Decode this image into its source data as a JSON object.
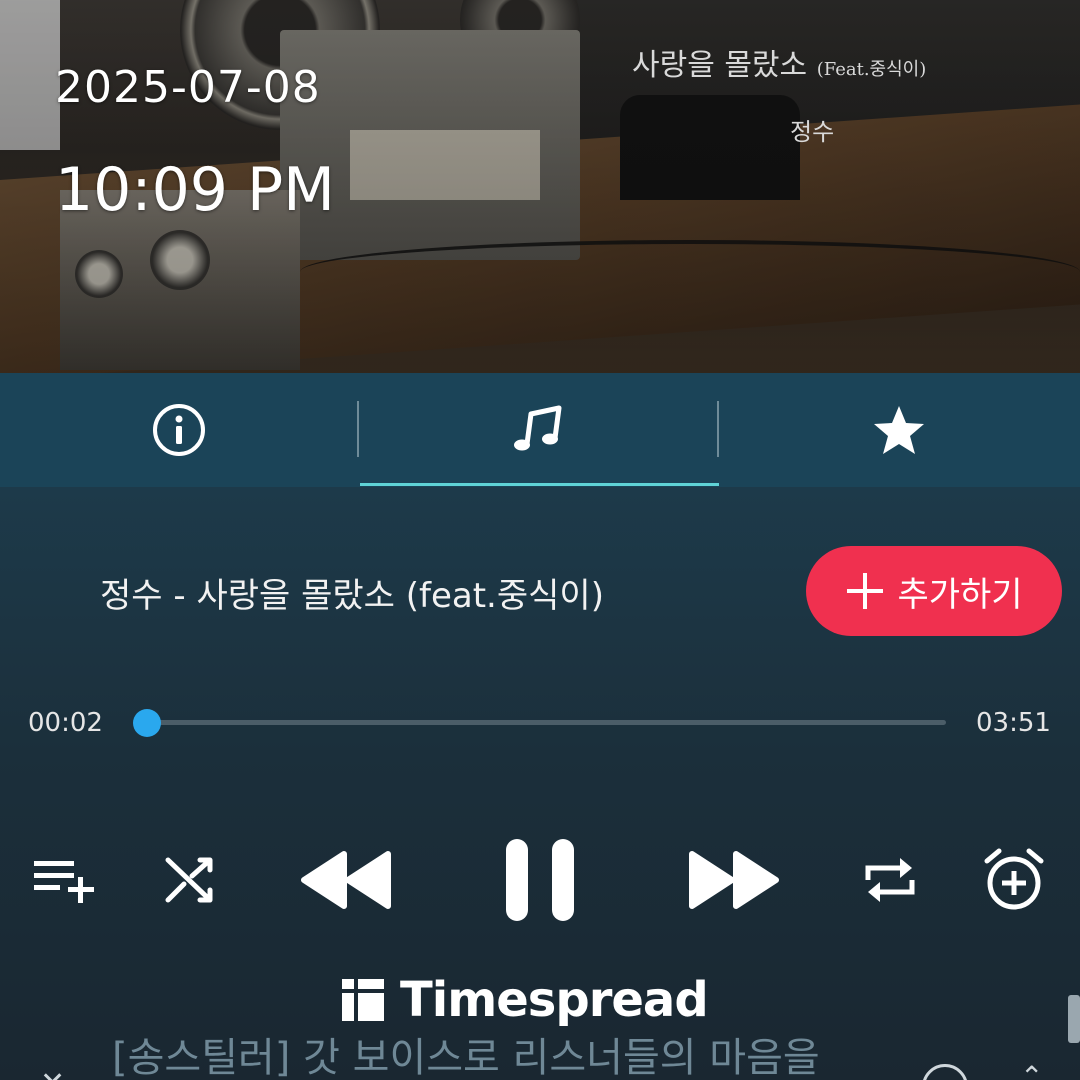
{
  "status": {
    "date": "2025-07-08",
    "time": "10:09 PM"
  },
  "album_art": {
    "title": "사랑을 몰랐소",
    "title_feat": "(Feat.중식이)",
    "artist": "정수"
  },
  "tabs": [
    {
      "icon": "info-icon",
      "active": false
    },
    {
      "icon": "music-note-icon",
      "active": true
    },
    {
      "icon": "star-icon",
      "active": false
    }
  ],
  "song": {
    "title_line": "정수 - 사랑을 몰랐소 (feat.중식이)",
    "add_label": "추가하기",
    "add_icon": "plus-icon"
  },
  "progress": {
    "current": "00:02",
    "total": "03:51",
    "fraction": 0.009
  },
  "controls": [
    "playlist-add-icon",
    "shuffle-icon",
    "rewind-icon",
    "pause-icon",
    "fast-forward-icon",
    "repeat-icon",
    "alarm-add-icon"
  ],
  "watermark": {
    "text": "Timespread"
  },
  "lyrics": {
    "line": "[송스틸러] 갓 보이스로 리스너들의 마음을"
  },
  "colors": {
    "tab_bar": "#1b4458",
    "accent_underline": "#5fd3d6",
    "add_button": "#f0304f",
    "progress": "#2aa8ee"
  }
}
